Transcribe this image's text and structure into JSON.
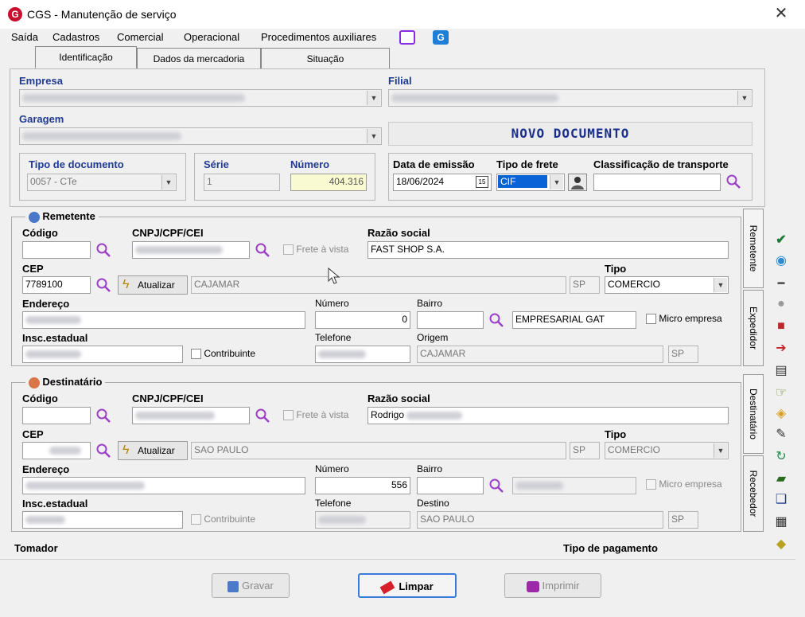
{
  "window": {
    "title": "CGS - Manutenção de serviço",
    "close": "✕"
  },
  "menu": [
    "Saída",
    "Cadastros",
    "Comercial",
    "Operacional",
    "Procedimentos auxiliares"
  ],
  "tabs": [
    "Identificação",
    "Dados da mercadoria",
    "Situação"
  ],
  "header": {
    "empresa_label": "Empresa",
    "filial_label": "Filial",
    "garagem_label": "Garagem",
    "status": "NOVO DOCUMENTO",
    "tipo_doc_label": "Tipo de documento",
    "tipo_doc_value": "0057 - CTe",
    "serie_label": "Série",
    "serie_value": "1",
    "numero_label": "Número",
    "numero_value": "404.316",
    "data_label": "Data de emissão",
    "data_value": "18/06/2024",
    "frete_label": "Tipo de frete",
    "frete_value": "CIF",
    "classif_label": "Classificação de transporte"
  },
  "remetente": {
    "title": "Remetente",
    "codigo_label": "Código",
    "cnpj_label": "CNPJ/CPF/CEI",
    "frete_vista": "Frete à vista",
    "razao_label": "Razão social",
    "razao_value": "FAST SHOP S.A.",
    "cep_label": "CEP",
    "cep_value": "7789100",
    "atualizar": "Atualizar",
    "cidade_value": "CAJAMAR",
    "uf_value": "SP",
    "tipo_label": "Tipo",
    "tipo_value": "COMERCIO",
    "endereco_label": "Endereço",
    "numero_label": "Número",
    "numero_value": "0",
    "bairro_label": "Bairro",
    "bairro_value": "EMPRESARIAL GAT",
    "micro": "Micro empresa",
    "insc_label": "Insc.estadual",
    "contribuinte": "Contribuinte",
    "telefone_label": "Telefone",
    "origem_label": "Origem",
    "origem_value": "CAJAMAR",
    "origem_uf": "SP"
  },
  "destinatario": {
    "title": "Destinatário",
    "codigo_label": "Código",
    "cnpj_label": "CNPJ/CPF/CEI",
    "frete_vista": "Frete à vista",
    "razao_label": "Razão social",
    "razao_value": "Rodrigo",
    "cep_label": "CEP",
    "atualizar": "Atualizar",
    "cidade_value": "SAO PAULO",
    "uf_value": "SP",
    "tipo_label": "Tipo",
    "tipo_value": "COMERCIO",
    "endereco_label": "Endereço",
    "numero_label": "Número",
    "numero_value": "556",
    "bairro_label": "Bairro",
    "micro": "Micro empresa",
    "insc_label": "Insc.estadual",
    "contribuinte": "Contribuinte",
    "telefone_label": "Telefone",
    "destino_label": "Destino",
    "destino_value": "SAO PAULO",
    "destino_uf": "SP"
  },
  "side_tabs": [
    "Remetente",
    "Expedidor",
    "Destinatário",
    "Recebedor"
  ],
  "footer": {
    "tomador_label": "Tomador",
    "tipo_pag_label": "Tipo de pagamento",
    "gravar": "Gravar",
    "limpar": "Limpar",
    "imprimir": "Imprimir"
  },
  "colors": {
    "label_blue": "#1f3a93",
    "status_blue": "#1a2f8a",
    "search_purple": "#9b3fc7",
    "brand_red": "#c8102e"
  }
}
